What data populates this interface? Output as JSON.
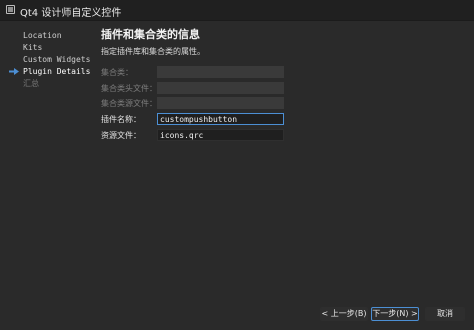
{
  "window": {
    "title": "Qt4 设计师自定义控件"
  },
  "nav": {
    "items": [
      {
        "label": "Location",
        "state": "done"
      },
      {
        "label": "Kits",
        "state": "done"
      },
      {
        "label": "Custom Widgets",
        "state": "done"
      },
      {
        "label": "Plugin Details",
        "state": "current"
      },
      {
        "label": "汇总",
        "state": "future"
      }
    ],
    "current_indicator_icon": "arrow-right-icon"
  },
  "page": {
    "title": "插件和集合类的信息",
    "subtitle": "指定插件库和集合类的属性。"
  },
  "form": {
    "collection_class": {
      "label": "集合类：",
      "value": "",
      "enabled": false
    },
    "collection_header": {
      "label": "集合类头文件：",
      "value": "",
      "enabled": false
    },
    "collection_source": {
      "label": "集合类源文件：",
      "value": "",
      "enabled": false
    },
    "plugin_name": {
      "label": "插件名称：",
      "value": "custompushbutton",
      "enabled": true,
      "focused": true
    },
    "resource_file": {
      "label": "资源文件：",
      "value": "icons.qrc",
      "enabled": true
    }
  },
  "buttons": {
    "back": "< 上一步(B)",
    "next": "下一步(N) >",
    "cancel": "取消"
  },
  "colors": {
    "background": "#2a2a2a",
    "accent": "#4c8fd4",
    "disabled_text": "#7d7d7d"
  }
}
